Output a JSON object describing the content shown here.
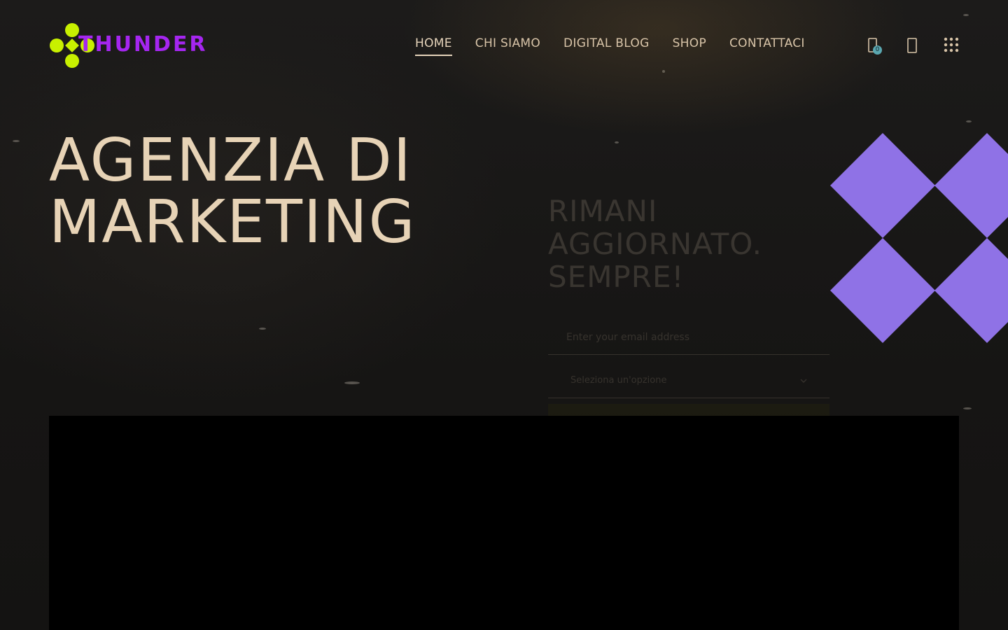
{
  "brand": {
    "name": "THUNDER",
    "text_color": "#a526f0",
    "mark_color": "#c8f000"
  },
  "nav": {
    "items": [
      {
        "label": "HOME",
        "active": true
      },
      {
        "label": "CHI SIAMO",
        "active": false
      },
      {
        "label": "DIGITAL BLOG",
        "active": false
      },
      {
        "label": "SHOP",
        "active": false
      },
      {
        "label": "CONTATTACI",
        "active": false
      }
    ]
  },
  "tools": {
    "cart_icon": "shopping-bag-icon",
    "cart_count": "0",
    "account_icon": "user-icon",
    "menu_icon": "grid-menu-icon"
  },
  "hero": {
    "title_line1": "AGENZIA DI",
    "title_line2": "MARKETING"
  },
  "newsletter": {
    "title_line1": "RIMANI",
    "title_line2": "AGGIORNATO.",
    "title_line3": "SEMPRE!",
    "email_placeholder": "Enter your email address",
    "select_value": "Seleziona un'opzione"
  },
  "colors": {
    "accent_text": "#e7d3b6",
    "diamond": "#8f72e6",
    "video_bg": "#000000"
  }
}
